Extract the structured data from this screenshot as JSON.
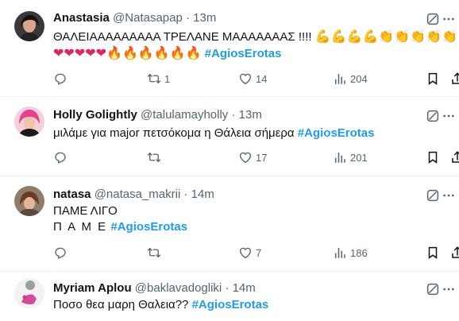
{
  "tweets": [
    {
      "name": "Anastasia",
      "handle": "@Natasapap",
      "dot": "·",
      "time": "13m",
      "text_line1": "ΘΑΛΕΙΑΑΑΑΑΑΑΑΑ ΤΡΕΛΑΝΕ ΜΑΑΑΑΑΑΑΣ !!!!",
      "emoji_line1": [
        "💪",
        "💪",
        "💪",
        "💪",
        "👏",
        "👏",
        "👏",
        "👏",
        "👏"
      ],
      "emoji_line2": [
        "❤",
        "❤",
        "❤",
        "❤",
        "❤",
        "🔥",
        "🔥",
        "🔥",
        "🔥",
        "🔥",
        "🔥"
      ],
      "hashtag": "#AgiosErotas",
      "replies": "",
      "retweets": "1",
      "likes": "14",
      "views": "204"
    },
    {
      "name": "Holly Golightly",
      "handle": "@talulamayholly",
      "dot": "·",
      "time": "13m",
      "text_line1": "μιλάμε για major πετσόκομα η Θάλεια σήμερα",
      "hashtag": "#AgiosErotas",
      "replies": "",
      "retweets": "",
      "likes": "17",
      "views": "201"
    },
    {
      "name": "natasa",
      "handle": "@natasa_makrii",
      "dot": "·",
      "time": "14m",
      "text_line1": "ΠΑΜΕ ΛΙΓΟ",
      "text_line2": "Π Α Μ Ε",
      "hashtag": "#AgiosErotas",
      "replies": "",
      "retweets": "",
      "likes": "7",
      "views": "186"
    },
    {
      "name": "Myriam Aplou",
      "handle": "@baklavadogliki",
      "dot": "·",
      "time": "14m",
      "text_line1": "Ποσο θεα μαρη Θαλεια??",
      "hashtag": "#AgiosErotas"
    }
  ],
  "icons": {
    "reply": "reply-icon",
    "retweet": "retweet-icon",
    "like": "heart-icon",
    "views": "views-icon",
    "bookmark": "bookmark-icon",
    "share": "share-icon",
    "grok": "grok-icon",
    "more": "more-icon"
  },
  "colors": {
    "hashtag": "#1d9bf0",
    "secondary": "#536471",
    "primary": "#0f1419"
  }
}
